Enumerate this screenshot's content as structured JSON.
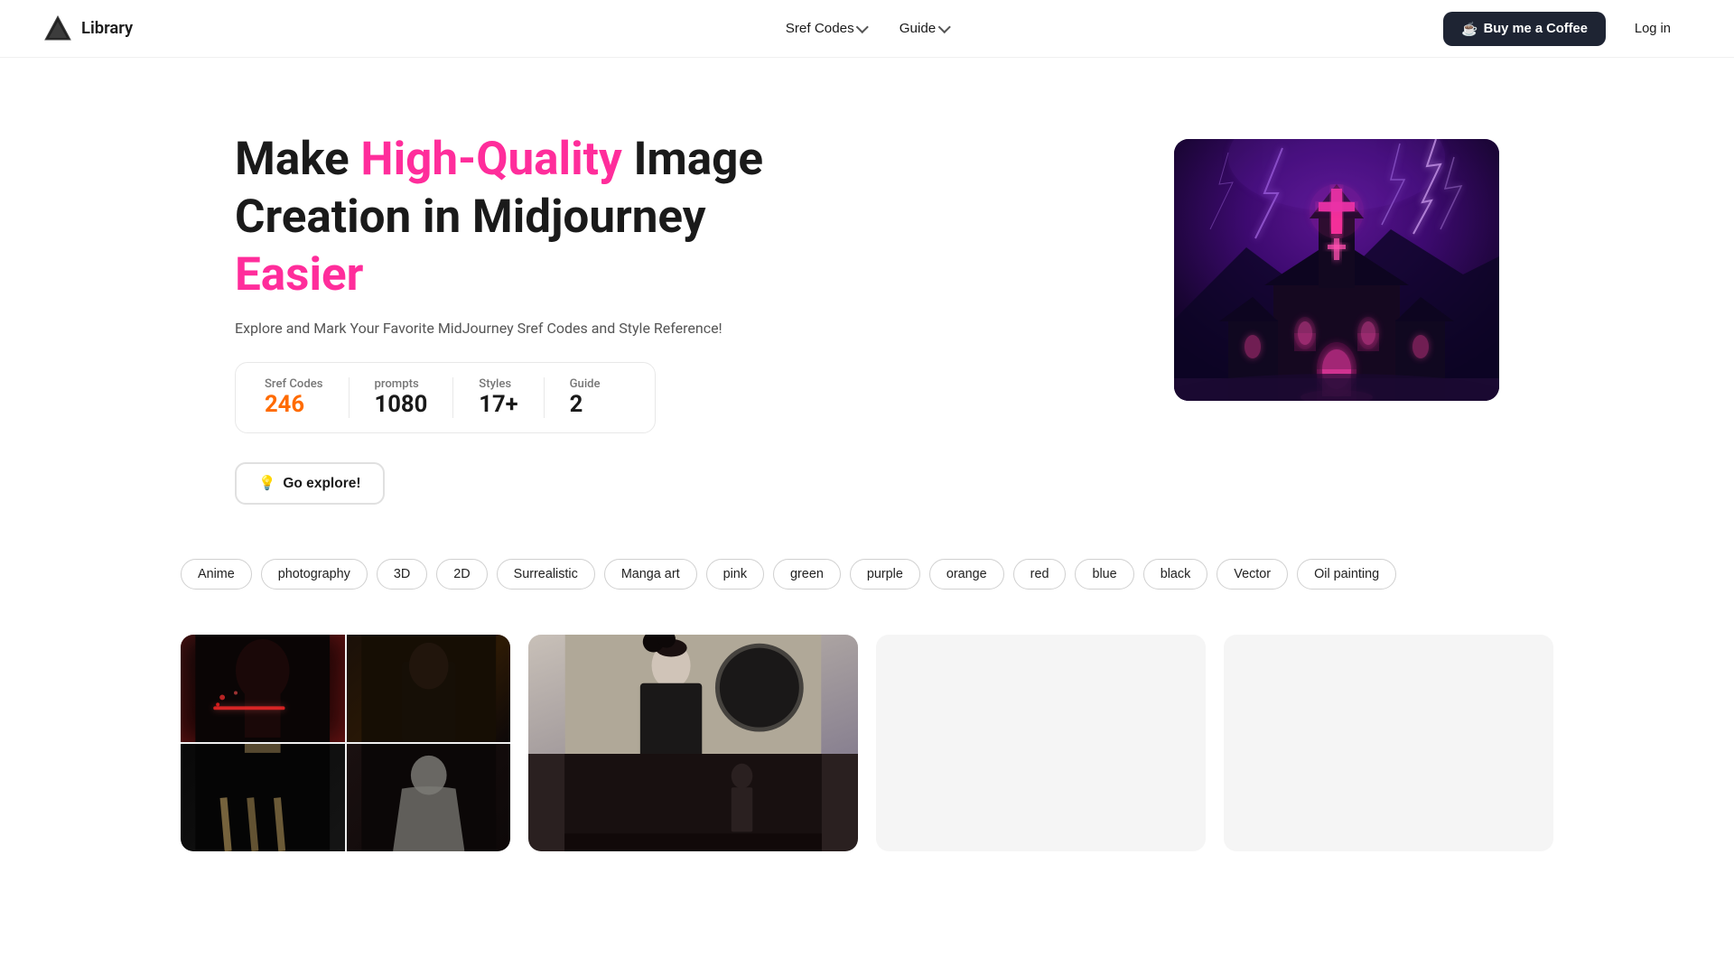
{
  "nav": {
    "logo_text": "Library",
    "menu_items": [
      {
        "label": "Sref Codes",
        "has_dropdown": true
      },
      {
        "label": "Guide",
        "has_dropdown": true
      }
    ],
    "coffee_button": "Buy me a Coffee",
    "login_button": "Log in",
    "coffee_icon": "☕"
  },
  "hero": {
    "title_line1": "Make ",
    "title_highlight": "High-Quality",
    "title_line2": " Image Creation in Midjourney",
    "title_line3": "Easier",
    "subtitle": "Explore and Mark Your Favorite MidJourney Sref Codes and Style Reference!",
    "stats": [
      {
        "label": "Sref Codes",
        "value": "246",
        "is_orange": true
      },
      {
        "label": "prompts",
        "value": "1080",
        "is_orange": false
      },
      {
        "label": "Styles",
        "value": "17+",
        "is_orange": false
      },
      {
        "label": "Guide",
        "value": "2",
        "is_orange": false
      }
    ],
    "explore_button": "Go explore!",
    "explore_icon": "💡"
  },
  "filters": {
    "chips": [
      "Anime",
      "photography",
      "3D",
      "2D",
      "Surrealistic",
      "Manga art",
      "pink",
      "green",
      "purple",
      "orange",
      "red",
      "blue",
      "black",
      "Vector",
      "Oil painting"
    ]
  },
  "gallery": {
    "cards": [
      {
        "type": "collage",
        "description": "Dark cinematic collage"
      },
      {
        "type": "japanese",
        "description": "Japanese style art"
      },
      {
        "type": "placeholder",
        "description": "Loading"
      },
      {
        "type": "placeholder",
        "description": "Loading"
      }
    ]
  }
}
